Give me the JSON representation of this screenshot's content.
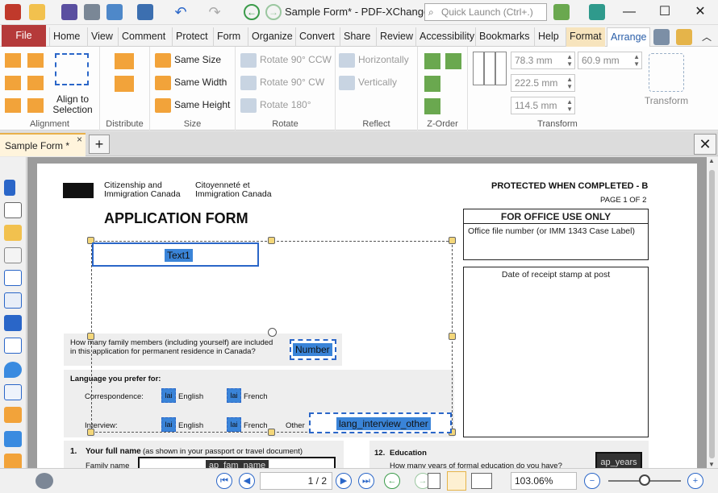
{
  "window": {
    "title": "Sample Form* - PDF-XChange ..",
    "quick_launch_placeholder": "Quick Launch (Ctrl+.)",
    "minimize": "—",
    "maximize": "☐",
    "close": "✕"
  },
  "menu": {
    "file": "File",
    "tabs": [
      "Home",
      "View",
      "Comment",
      "Protect",
      "Form",
      "Organize",
      "Convert",
      "Share",
      "Review",
      "Accessibility",
      "Bookmarks",
      "Help",
      "Format",
      "Arrange"
    ]
  },
  "ribbon": {
    "alignment": {
      "label": "Alignment",
      "align_to_selection": "Align to\nSelection"
    },
    "distribute": {
      "label": "Distribute"
    },
    "size": {
      "label": "Size",
      "same_size": "Same Size",
      "same_width": "Same Width",
      "same_height": "Same Height"
    },
    "rotate": {
      "label": "Rotate",
      "rotate_ccw": "Rotate 90° CCW",
      "rotate_cw": "Rotate 90° CW",
      "rotate_180": "Rotate 180°"
    },
    "reflect": {
      "label": "Reflect",
      "horizontally": "Horizontally",
      "vertically": "Vertically"
    },
    "zorder": {
      "label": "Z-Order"
    },
    "transform": {
      "label": "Transform",
      "x": "78.3 mm",
      "y": "60.9 mm",
      "width": "222.5 mm",
      "height": "114.5 mm",
      "transform_button": "Transform"
    }
  },
  "doc_tab": {
    "name": "Sample Form *",
    "close": "×",
    "new": "+",
    "close_doc": "✕"
  },
  "page": {
    "agency_en": "Citizenship and\nImmigration Canada",
    "agency_fr": "Citoyenneté et\nImmigration Canada",
    "form_title": "APPLICATION FORM",
    "protected": "PROTECTED WHEN COMPLETED - B",
    "page_of": "PAGE 1 OF 2",
    "office_use": "FOR OFFICE USE ONLY",
    "office_file": "Office file number (or IMM 1343 Case Label)",
    "receipt_stamp": "Date of receipt stamp at post",
    "text1": "Text1",
    "family_question": "How many family members (including yourself) are included\nin this application for permanent residence in Canada?",
    "number_field": "Number",
    "language_prefer": "Language you prefer for:",
    "correspondence": "Correspondence:",
    "interview": "Interview:",
    "english": "English",
    "french": "French",
    "other": "Other",
    "lang_abbrev": "lai",
    "lang_interview_other": "lang_interview_other",
    "q1_num": "1.",
    "q1_title": "Your full name",
    "q1_sub": "(as shown in your passport or travel document)",
    "family_name": "Family name",
    "ap_fam_name": "ap_fam_name",
    "q12_num": "12.",
    "q12_title": "Education",
    "q12_question": "How many years of formal education do you have?",
    "ap_years": "ap_years"
  },
  "status": {
    "page_display": "1 / 2",
    "zoom": "103.06%"
  }
}
